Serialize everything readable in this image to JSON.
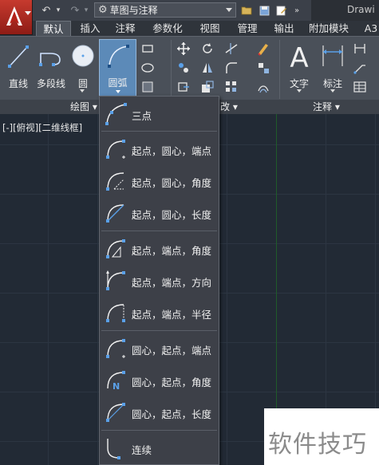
{
  "title_bar": {
    "workspace": "草图与注释",
    "doc_title": "Drawi"
  },
  "tabs": [
    {
      "label": "默认",
      "active": true
    },
    {
      "label": "插入",
      "active": false
    },
    {
      "label": "注释",
      "active": false
    },
    {
      "label": "参数化",
      "active": false
    },
    {
      "label": "视图",
      "active": false
    },
    {
      "label": "管理",
      "active": false
    },
    {
      "label": "输出",
      "active": false
    },
    {
      "label": "附加模块",
      "active": false
    },
    {
      "label": "A3",
      "active": false
    }
  ],
  "ribbon": {
    "draw_tools": {
      "line": "直线",
      "polyline": "多段线",
      "circle": "圆",
      "arc": "圆弧"
    },
    "annotation_tools": {
      "text": "文字",
      "dimension": "标注"
    },
    "panels": {
      "draw": "绘图",
      "modify_partial": "改",
      "annotation": "注释"
    }
  },
  "viewport": {
    "label": "[-][俯视][二维线框]"
  },
  "arc_menu": {
    "items": [
      {
        "label": "三点",
        "icon": "arc-3point-icon"
      },
      {
        "label": "起点，圆心，端点",
        "icon": "arc-start-center-end-icon"
      },
      {
        "label": "起点，圆心，角度",
        "icon": "arc-start-center-angle-icon"
      },
      {
        "label": "起点，圆心，长度",
        "icon": "arc-start-center-length-icon"
      },
      {
        "label": "起点，端点，角度",
        "icon": "arc-start-end-angle-icon"
      },
      {
        "label": "起点，端点，方向",
        "icon": "arc-start-end-direction-icon"
      },
      {
        "label": "起点，端点，半径",
        "icon": "arc-start-end-radius-icon"
      },
      {
        "label": "圆心，起点，端点",
        "icon": "arc-center-start-end-icon"
      },
      {
        "label": "圆心，起点，角度",
        "icon": "arc-center-start-angle-icon"
      },
      {
        "label": "圆心，起点，长度",
        "icon": "arc-center-start-length-icon"
      },
      {
        "label": "连续",
        "icon": "arc-continue-icon"
      }
    ]
  },
  "watermark": "软件技巧",
  "colors": {
    "app_button": "#c63a2e",
    "ribbon": "#4a5059",
    "canvas": "#222a35",
    "selected_tool": "#5c8ab8"
  }
}
